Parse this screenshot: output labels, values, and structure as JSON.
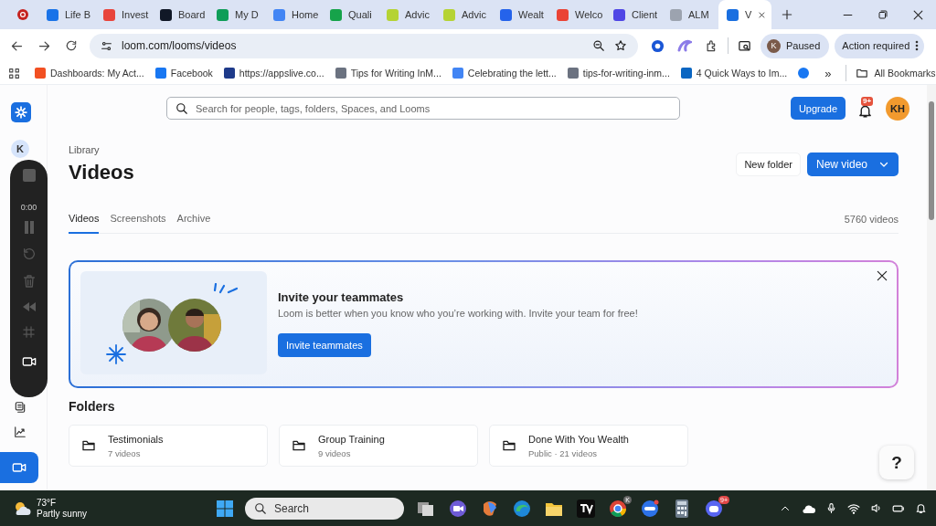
{
  "browser": {
    "tabs": [
      {
        "title": "Life B",
        "color": "#1a73e8",
        "selected": false
      },
      {
        "title": "Invest",
        "color": "#e8453c",
        "selected": false
      },
      {
        "title": "Board",
        "color": "#111827",
        "selected": false
      },
      {
        "title": "My D",
        "color": "#0f9d58",
        "selected": false
      },
      {
        "title": "Home",
        "color": "#4285f4",
        "selected": false
      },
      {
        "title": "Quali",
        "color": "#16a34a",
        "selected": false
      },
      {
        "title": "Advic",
        "color": "#b5d334",
        "selected": false
      },
      {
        "title": "Advic",
        "color": "#b5d334",
        "selected": false
      },
      {
        "title": "Wealt",
        "color": "#2563eb",
        "selected": false
      },
      {
        "title": "Welco",
        "color": "#ea4335",
        "selected": false
      },
      {
        "title": "Client",
        "color": "#4f46e5",
        "selected": false
      },
      {
        "title": "ALM",
        "color": "#9ca3af",
        "selected": false
      },
      {
        "title": "V",
        "color": "#1a6fe0",
        "selected": true
      }
    ],
    "address": "loom.com/looms/videos",
    "profile": {
      "initial": "K",
      "label": "Paused"
    },
    "action": "Action required",
    "bookmarks": [
      {
        "title": "Dashboards: My Act...",
        "color": "#f25022"
      },
      {
        "title": "Facebook",
        "color": "#1877f2"
      },
      {
        "title": "https://appslive.co...",
        "color": "#1e3a8a"
      },
      {
        "title": "Tips for Writing InM...",
        "color": "#6b7280"
      },
      {
        "title": "Celebrating the lett...",
        "color": "#4285f4"
      },
      {
        "title": "tips-for-writing-inm...",
        "color": "#6b7280"
      },
      {
        "title": "4 Quick Ways to Im...",
        "color": "#0a66c2"
      },
      {
        "color": "#1877f2"
      }
    ],
    "overflow": "»",
    "all_bookmarks": "All Bookmarks"
  },
  "sidebar": {
    "avatar": "K",
    "recorder_time": "0:00",
    "items": [
      {
        "kind": "notes",
        "selected": false
      },
      {
        "kind": "insights",
        "selected": false
      },
      {
        "kind": "record",
        "selected": true
      }
    ]
  },
  "header": {
    "search_placeholder": "Search for people, tags, folders, Spaces, and Looms",
    "upgrade": "Upgrade",
    "notifications_badge": "9+",
    "avatar": "KH"
  },
  "library": {
    "eyebrow": "Library",
    "title": "Videos",
    "new_folder": "New folder",
    "new_video": "New video",
    "tabs": [
      {
        "label": "Videos",
        "selected": true
      },
      {
        "label": "Screenshots",
        "selected": false
      },
      {
        "label": "Archive",
        "selected": false
      }
    ],
    "count": "5760 videos"
  },
  "banner": {
    "kind": "picture",
    "title": "Invite your teammates",
    "description": "Loom is better when you know who you’re working with. Invite your team for free!",
    "button": "Invite teammates"
  },
  "folders": {
    "heading": "Folders",
    "items": [
      {
        "name": "Testimonials",
        "meta": "7 videos"
      },
      {
        "name": "Group Training",
        "meta": "9 videos"
      },
      {
        "name": "Done With You Wealth",
        "meta": "Public · 21 videos"
      }
    ]
  },
  "help": "?",
  "taskbar": {
    "temperature": "73°F",
    "condition": "Partly sunny",
    "search": "Search",
    "browser_badge": "K",
    "chat_badge": "9+"
  }
}
